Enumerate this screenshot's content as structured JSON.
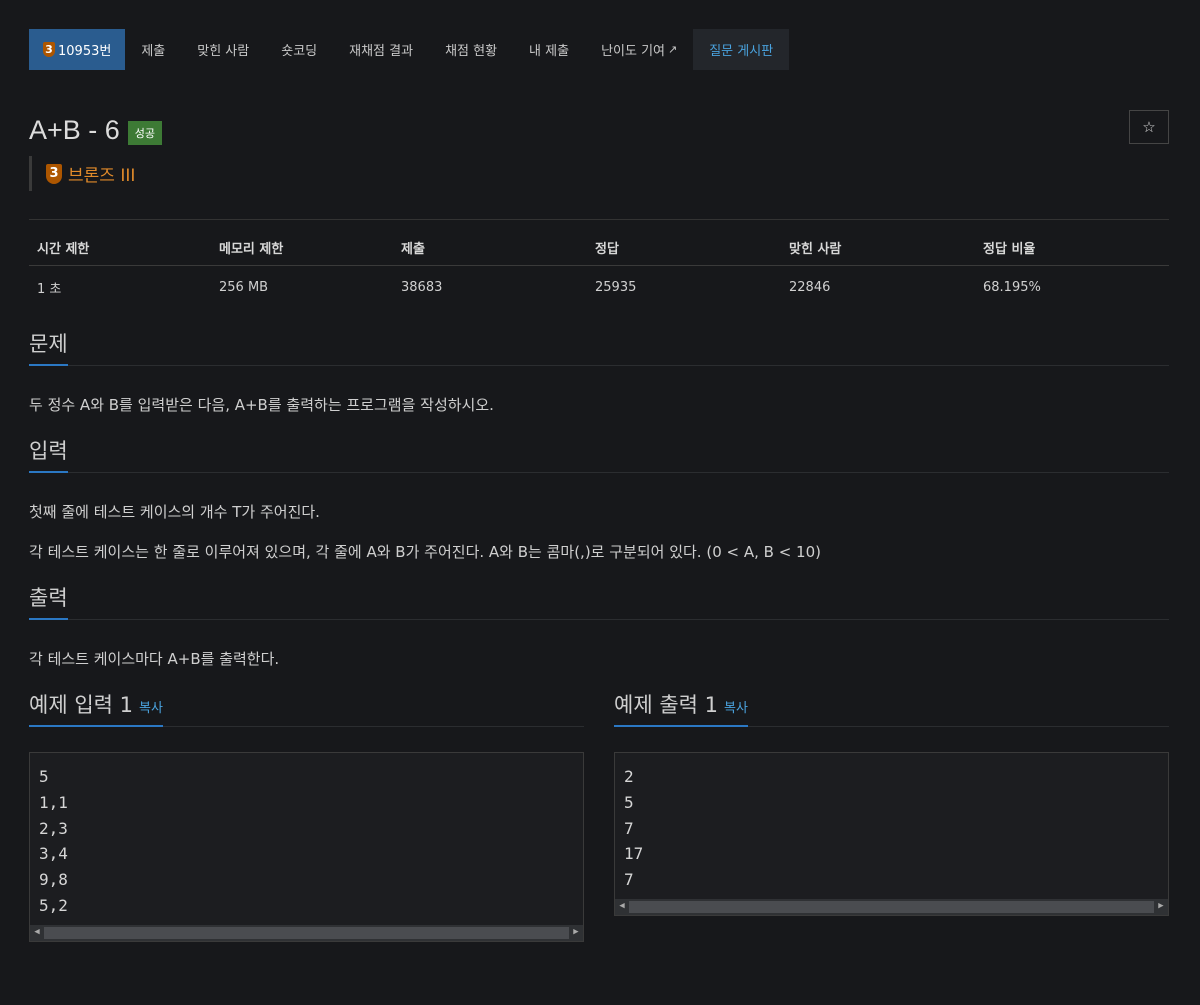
{
  "tabs": [
    {
      "label": "10953번",
      "badge": "3"
    },
    {
      "label": "제출"
    },
    {
      "label": "맞힌 사람"
    },
    {
      "label": "숏코딩"
    },
    {
      "label": "재채점 결과"
    },
    {
      "label": "채점 현황"
    },
    {
      "label": "내 제출"
    },
    {
      "label": "난이도 기여"
    },
    {
      "label": "질문 게시판"
    }
  ],
  "problem": {
    "title": "A+B - 6",
    "status_label": "성공",
    "tier_number": "3",
    "tier_name": "브론즈 III"
  },
  "stats": {
    "headers": [
      "시간 제한",
      "메모리 제한",
      "제출",
      "정답",
      "맞힌 사람",
      "정답 비율"
    ],
    "values": [
      "1 초",
      "256 MB",
      "38683",
      "25935",
      "22846",
      "68.195%"
    ]
  },
  "sections": {
    "problem_title": "문제",
    "problem_text": "두 정수 A와 B를 입력받은 다음, A+B를 출력하는 프로그램을 작성하시오.",
    "input_title": "입력",
    "input_text_1": "첫째 줄에 테스트 케이스의 개수 T가 주어진다.",
    "input_text_2": "각 테스트 케이스는 한 줄로 이루어져 있으며, 각 줄에 A와 B가 주어진다. A와 B는 콤마(,)로 구분되어 있다. (0 < A, B < 10)",
    "output_title": "출력",
    "output_text": "각 테스트 케이스마다 A+B를 출력한다."
  },
  "samples": {
    "input_title": "예제 입력 1",
    "output_title": "예제 출력 1",
    "copy_label": "복사",
    "input_lines": [
      "5",
      "1,1",
      "2,3",
      "3,4",
      "9,8",
      "5,2"
    ],
    "output_lines": [
      "2",
      "5",
      "7",
      "17",
      "7"
    ]
  },
  "colors": {
    "background": "#17181b",
    "active_tab": "#2a5c8f",
    "bronze": "#ad5600",
    "success": "#3d7a35",
    "link": "#4aa3df"
  }
}
